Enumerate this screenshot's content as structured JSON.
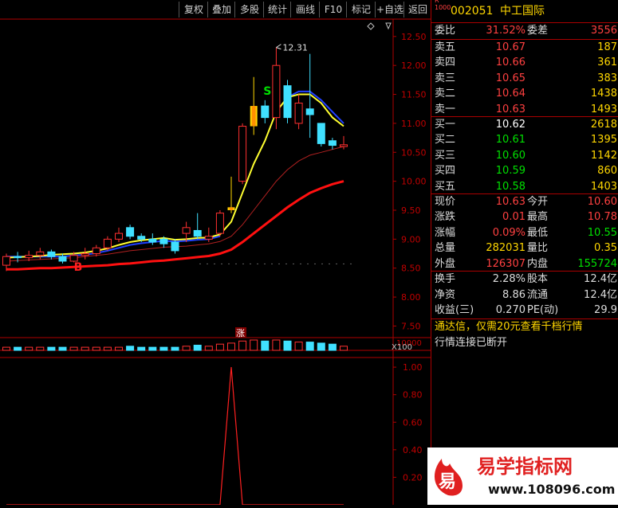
{
  "toolbar": {
    "buttons": [
      "复权",
      "叠加",
      "多股",
      "统计",
      "画线",
      "F10",
      "标记",
      "+自选",
      "返回"
    ]
  },
  "stock": {
    "code_prefix": "R\n1000",
    "code": "002051",
    "name": "中工国际"
  },
  "order_book": {
    "ratio_label": "委比",
    "ratio": "31.52%",
    "diff_label": "委差",
    "diff": "3556",
    "sells": [
      {
        "label": "卖五",
        "price": "10.67",
        "vol": "187"
      },
      {
        "label": "卖四",
        "price": "10.66",
        "vol": "361"
      },
      {
        "label": "卖三",
        "price": "10.65",
        "vol": "383"
      },
      {
        "label": "卖二",
        "price": "10.64",
        "vol": "1438"
      },
      {
        "label": "卖一",
        "price": "10.63",
        "vol": "1493"
      }
    ],
    "buys": [
      {
        "label": "买一",
        "price": "10.62",
        "vol": "2618"
      },
      {
        "label": "买二",
        "price": "10.61",
        "vol": "1395"
      },
      {
        "label": "买三",
        "price": "10.60",
        "vol": "1142"
      },
      {
        "label": "买四",
        "price": "10.59",
        "vol": "860"
      },
      {
        "label": "买五",
        "price": "10.58",
        "vol": "1403"
      }
    ]
  },
  "stats": [
    {
      "l1": "现价",
      "v1": "10.63",
      "l2": "今开",
      "v2": "10.60",
      "c1": "#ff4040",
      "c2": "#ff4040"
    },
    {
      "l1": "涨跌",
      "v1": "0.01",
      "l2": "最高",
      "v2": "10.78",
      "c1": "#ff4040",
      "c2": "#ff4040"
    },
    {
      "l1": "涨幅",
      "v1": "0.09%",
      "l2": "最低",
      "v2": "10.55",
      "c1": "#ff4040",
      "c2": "#00e000"
    },
    {
      "l1": "总量",
      "v1": "282031",
      "l2": "量比",
      "v2": "0.35",
      "c1": "#ffd700",
      "c2": "#ffd700"
    },
    {
      "l1": "外盘",
      "v1": "126307",
      "l2": "内盘",
      "v2": "155724",
      "c1": "#ff4040",
      "c2": "#00e000"
    }
  ],
  "fundamentals": [
    {
      "l1": "换手",
      "v1": "2.28%",
      "l2": "股本",
      "v2": "12.4亿"
    },
    {
      "l1": "净资",
      "v1": "8.86",
      "l2": "流通",
      "v2": "12.4亿"
    },
    {
      "l1": "收益(三)",
      "v1": "0.270",
      "l2": "PE(动)",
      "v2": "29.9"
    }
  ],
  "notice": {
    "line1": "通达信，仅需20元查看千档行情",
    "line2": "行情连接已断开"
  },
  "chart_data": {
    "type": "candlestick",
    "price_axis": {
      "ticks": [
        "12.50",
        "12.00",
        "11.50",
        "11.00",
        "10.50",
        "10.00",
        "9.50",
        "9.00",
        "8.50",
        "8.00",
        "7.50"
      ],
      "range": [
        7.3,
        12.8
      ]
    },
    "high_label": "12.31",
    "signals": [
      {
        "text": "B",
        "color": "#ff2020"
      },
      {
        "text": "S",
        "color": "#00e000"
      }
    ],
    "limit_up_label": "涨",
    "candles": [
      [
        8.55,
        8.7,
        8.45,
        8.75
      ],
      [
        8.7,
        8.68,
        8.6,
        8.78
      ],
      [
        8.68,
        8.72,
        8.62,
        8.8
      ],
      [
        8.72,
        8.78,
        8.65,
        8.85
      ],
      [
        8.78,
        8.7,
        8.65,
        8.82
      ],
      [
        8.7,
        8.62,
        8.58,
        8.75
      ],
      [
        8.62,
        8.72,
        8.6,
        8.78
      ],
      [
        8.72,
        8.75,
        8.65,
        8.85
      ],
      [
        8.75,
        8.85,
        8.7,
        8.9
      ],
      [
        8.85,
        9.0,
        8.8,
        9.05
      ],
      [
        9.0,
        9.1,
        8.95,
        9.2
      ],
      [
        9.2,
        9.05,
        9.0,
        9.25
      ],
      [
        9.05,
        9.0,
        8.95,
        9.1
      ],
      [
        9.0,
        8.95,
        8.9,
        9.1
      ],
      [
        9.0,
        8.92,
        8.85,
        9.05
      ],
      [
        8.95,
        8.8,
        8.75,
        9.0
      ],
      [
        9.1,
        9.2,
        8.95,
        9.3
      ],
      [
        9.15,
        9.05,
        9.0,
        9.45
      ],
      [
        9.0,
        9.05,
        8.95,
        9.2
      ],
      [
        9.1,
        9.45,
        9.05,
        9.5
      ],
      [
        9.5,
        9.55,
        9.45,
        10.08
      ],
      [
        10.0,
        10.95,
        9.95,
        11.0
      ],
      [
        10.95,
        11.3,
        10.8,
        11.8
      ],
      [
        11.3,
        11.1,
        11.0,
        11.4
      ],
      [
        11.1,
        12.0,
        10.9,
        12.31
      ],
      [
        11.65,
        11.1,
        11.0,
        11.75
      ],
      [
        11.0,
        11.35,
        10.9,
        11.5
      ],
      [
        11.25,
        11.15,
        10.75,
        12.2
      ],
      [
        11.0,
        10.65,
        10.6,
        11.0
      ],
      [
        10.7,
        10.62,
        10.55,
        10.75
      ],
      [
        10.6,
        10.63,
        10.55,
        10.78
      ]
    ],
    "ma_yellow": [
      8.68,
      8.69,
      8.7,
      8.71,
      8.73,
      8.74,
      8.75,
      8.77,
      8.8,
      8.84,
      8.9,
      8.95,
      8.98,
      9.0,
      9.02,
      8.99,
      9.0,
      9.02,
      9.03,
      9.08,
      9.3,
      9.8,
      10.3,
      10.7,
      11.2,
      11.45,
      11.5,
      11.5,
      11.35,
      11.1,
      10.95
    ],
    "ma_blue": [
      8.7,
      8.7,
      8.7,
      8.7,
      8.7,
      8.7,
      8.72,
      8.73,
      8.76,
      8.8,
      8.85,
      8.9,
      8.93,
      8.95,
      8.97,
      8.96,
      8.97,
      8.99,
      9.0,
      9.05,
      null,
      null,
      null,
      null,
      null,
      11.45,
      11.55,
      11.55,
      11.4,
      11.2,
      11.0
    ],
    "ma_darkred": [
      8.62,
      8.63,
      8.64,
      8.65,
      8.66,
      8.67,
      8.68,
      8.7,
      8.72,
      8.74,
      8.77,
      8.8,
      8.82,
      8.84,
      8.86,
      8.87,
      8.88,
      8.9,
      8.92,
      8.96,
      9.05,
      9.25,
      9.5,
      9.75,
      10.0,
      10.2,
      10.35,
      10.45,
      10.5,
      10.55,
      10.6
    ],
    "ma_red": [
      8.48,
      8.48,
      8.49,
      8.5,
      8.5,
      8.51,
      8.52,
      8.53,
      8.54,
      8.55,
      8.57,
      8.58,
      8.6,
      8.62,
      8.63,
      8.65,
      8.67,
      8.69,
      8.71,
      8.75,
      8.82,
      8.95,
      9.1,
      9.25,
      9.4,
      9.55,
      9.68,
      9.8,
      9.88,
      9.95,
      10.0
    ],
    "volume_axis": {
      "label": "10000",
      "unit": "X100"
    },
    "volumes": [
      3,
      3,
      3,
      3,
      3,
      3,
      3,
      3,
      3,
      3,
      3,
      4,
      3,
      3,
      3,
      3,
      4,
      5,
      4,
      6,
      7,
      9,
      10,
      9,
      10,
      9,
      8,
      8,
      7,
      6,
      4
    ],
    "indicator_axis": {
      "ticks": [
        "1.00",
        "0.80",
        "0.60",
        "0.40",
        "0.20"
      ],
      "range": [
        0,
        1.07
      ]
    },
    "indicator": [
      0,
      0,
      0,
      0,
      0,
      0,
      0,
      0,
      0,
      0,
      0,
      0,
      0,
      0,
      0,
      0,
      0,
      0,
      0,
      0,
      1,
      0,
      0,
      0,
      0,
      0,
      0,
      0,
      0,
      0,
      0
    ]
  },
  "logo": {
    "mark": "易",
    "name": "易学指标网",
    "url": "www.108096.com"
  }
}
